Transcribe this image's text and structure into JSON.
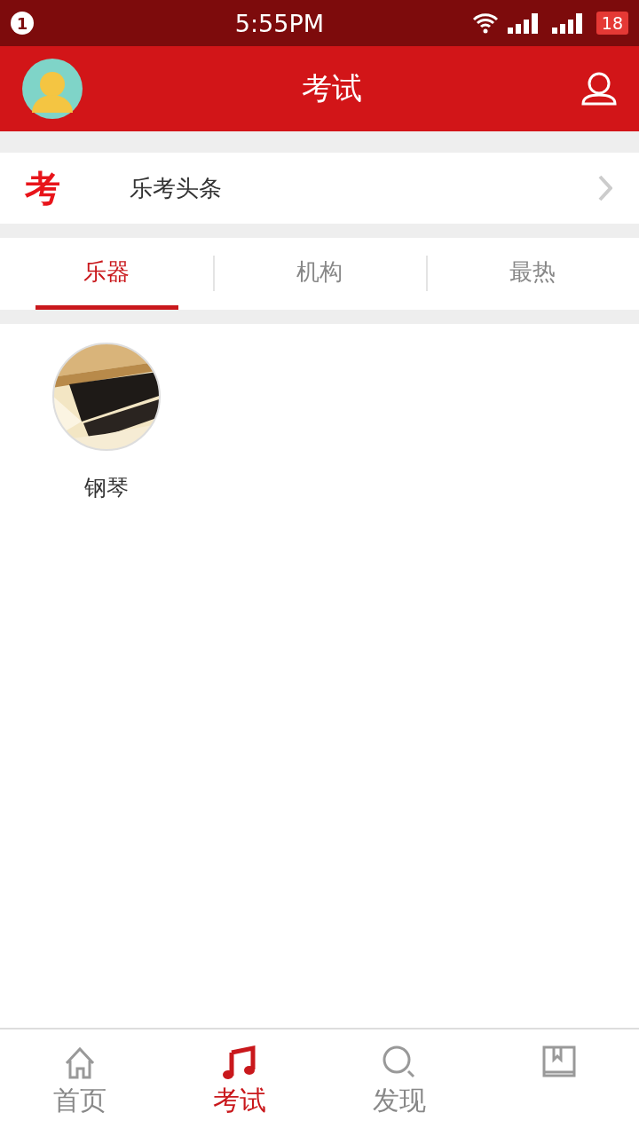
{
  "status_bar": {
    "notification": "1",
    "time": "5:55PM",
    "battery": "18"
  },
  "header": {
    "title": "考试"
  },
  "headline": {
    "badge": "考",
    "label": "乐考头条"
  },
  "tabs": [
    {
      "label": "乐器",
      "selected": true
    },
    {
      "label": "机构",
      "selected": false
    },
    {
      "label": "最热",
      "selected": false
    }
  ],
  "items": [
    {
      "label": "钢琴",
      "kind": "picture"
    }
  ],
  "bottom_nav": [
    {
      "label": "首页",
      "kind": "home",
      "selected": false
    },
    {
      "label": "考试",
      "kind": "music",
      "selected": true
    },
    {
      "label": "发现",
      "kind": "search",
      "selected": false
    },
    {
      "kind": "book",
      "selected": false
    }
  ]
}
